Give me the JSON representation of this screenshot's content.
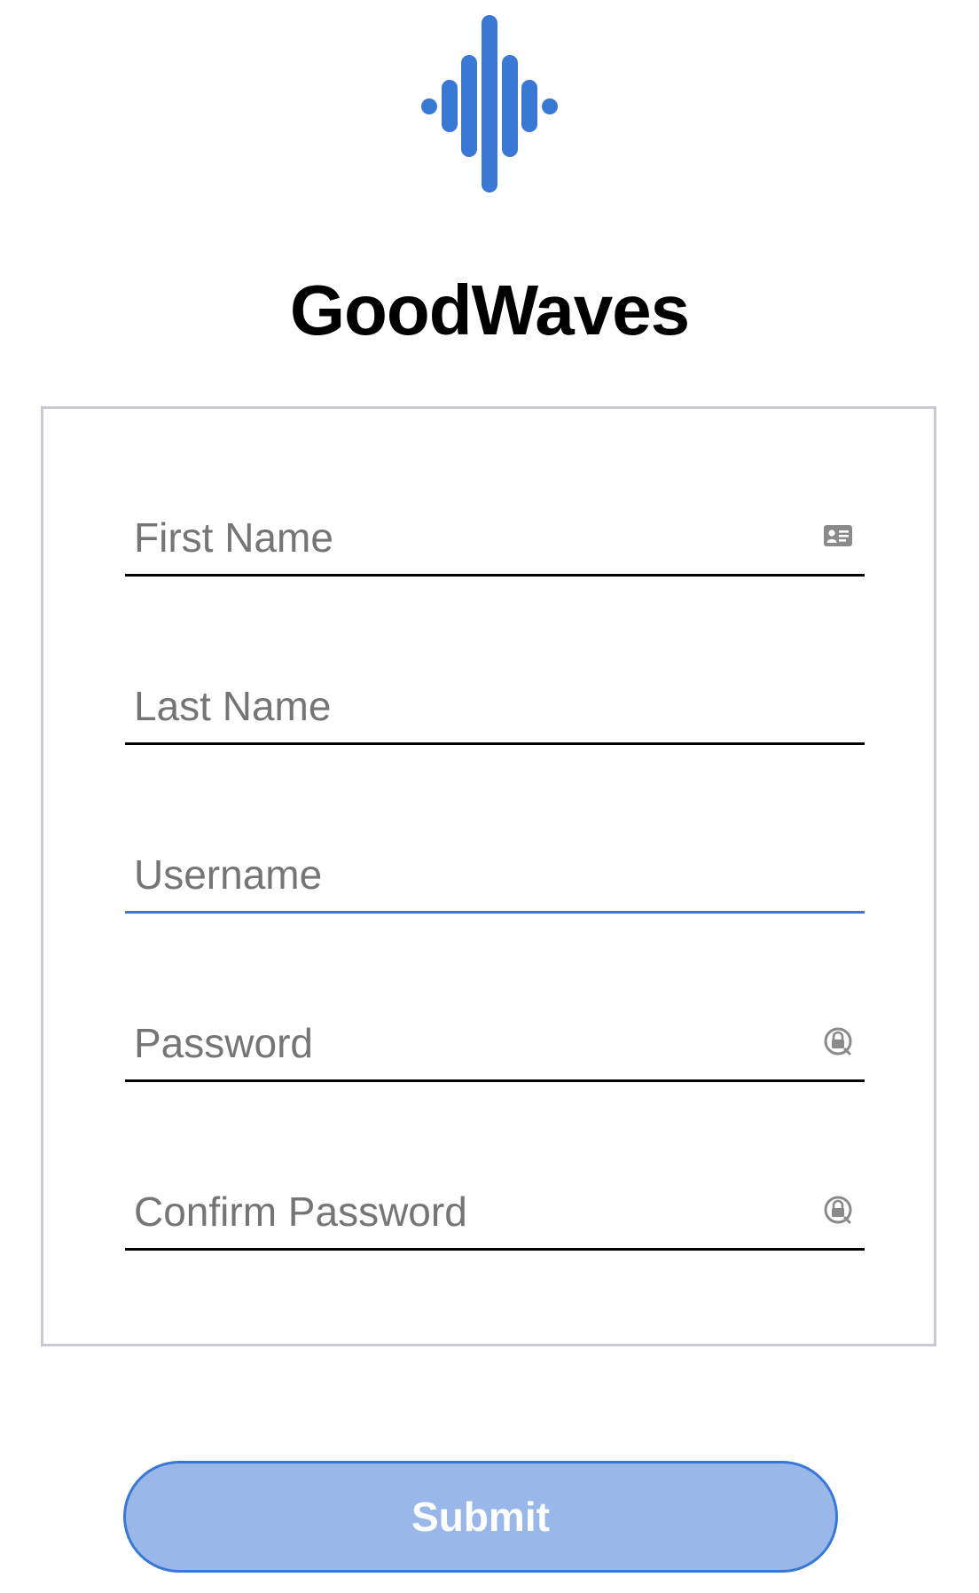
{
  "app": {
    "title": "GoodWaves",
    "logo_icon": "soundwave-logo-icon",
    "accent_color": "#3a78d6"
  },
  "form": {
    "fields": [
      {
        "placeholder": "First Name",
        "value": "",
        "icon": "contact-card-icon",
        "state": "default"
      },
      {
        "placeholder": "Last Name",
        "value": "",
        "icon": "",
        "state": "default"
      },
      {
        "placeholder": "Username",
        "value": "",
        "icon": "",
        "state": "focused"
      },
      {
        "placeholder": "Password",
        "value": "",
        "icon": "password-key-icon",
        "state": "default"
      },
      {
        "placeholder": "Confirm Password",
        "value": "",
        "icon": "password-key-icon",
        "state": "default"
      }
    ],
    "submit_label": "Submit",
    "submit_state": "disabled"
  }
}
